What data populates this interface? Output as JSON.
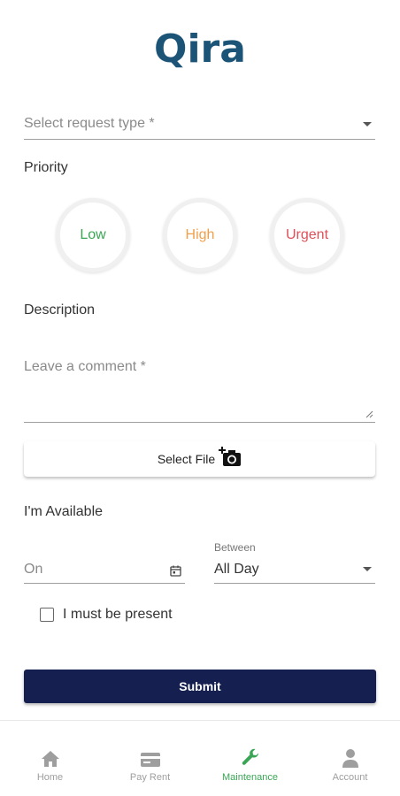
{
  "logo": {
    "text": "Qira"
  },
  "form": {
    "request_type": {
      "placeholder": "Select request type *"
    },
    "priority": {
      "label": "Priority",
      "options": [
        {
          "label": "Low",
          "color": "#3aa655"
        },
        {
          "label": "High",
          "color": "#f0a04b"
        },
        {
          "label": "Urgent",
          "color": "#e0505a"
        }
      ]
    },
    "description": {
      "label": "Description",
      "placeholder": "Leave a comment *"
    },
    "file": {
      "label": "Select File",
      "icon": "add-camera-icon"
    },
    "availability": {
      "label": "I'm Available",
      "date_placeholder": "On",
      "between_label": "Between",
      "between_value": "All Day",
      "must_be_present_label": "I must be present",
      "must_be_present_checked": false
    },
    "submit_label": "Submit"
  },
  "nav": {
    "items": [
      {
        "label": "Home",
        "icon": "home-icon",
        "active": false
      },
      {
        "label": "Pay Rent",
        "icon": "credit-card-icon",
        "active": false
      },
      {
        "label": "Maintenance",
        "icon": "wrench-icon",
        "active": true
      },
      {
        "label": "Account",
        "icon": "person-icon",
        "active": false
      }
    ]
  },
  "colors": {
    "brand_blue": "#1b5477",
    "brand_green": "#3cb54a",
    "submit_bg": "#162050",
    "nav_active": "#3aa655",
    "nav_inactive": "#9e9e9e"
  }
}
